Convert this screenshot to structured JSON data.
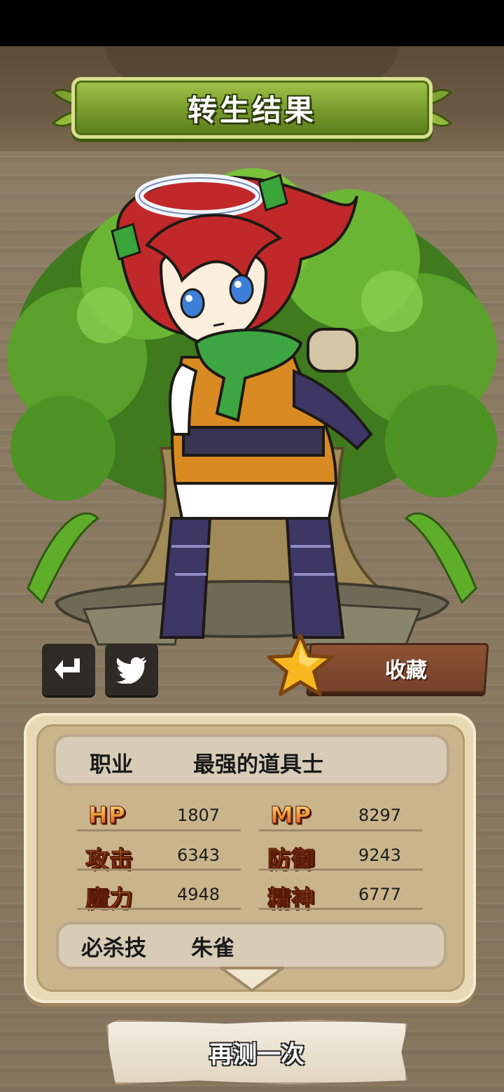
{
  "header": {
    "title": "转生结果"
  },
  "actions": {
    "share_icon": "return-arrow-icon",
    "twitter_icon": "twitter-bird-icon",
    "favorite_icon": "star-icon",
    "favorite_label": "收藏"
  },
  "profile": {
    "job_label": "职业",
    "job_value": "最强的道具士",
    "stats": [
      {
        "label": "HP",
        "value": "1807"
      },
      {
        "label": "MP",
        "value": "8297"
      },
      {
        "label": "攻击",
        "value": "6343"
      },
      {
        "label": "防御",
        "value": "9243"
      },
      {
        "label": "魔力",
        "value": "4948"
      },
      {
        "label": "精神",
        "value": "6777"
      }
    ],
    "skill_label": "必杀技",
    "skill_value": "朱雀"
  },
  "footer": {
    "retry_label": "再测一次"
  },
  "colors": {
    "title_green": "#789a2c",
    "stat_label_orange": "#f2a23a",
    "panel_cream": "#e8d9b5",
    "wood_brown": "#8a7a62"
  }
}
